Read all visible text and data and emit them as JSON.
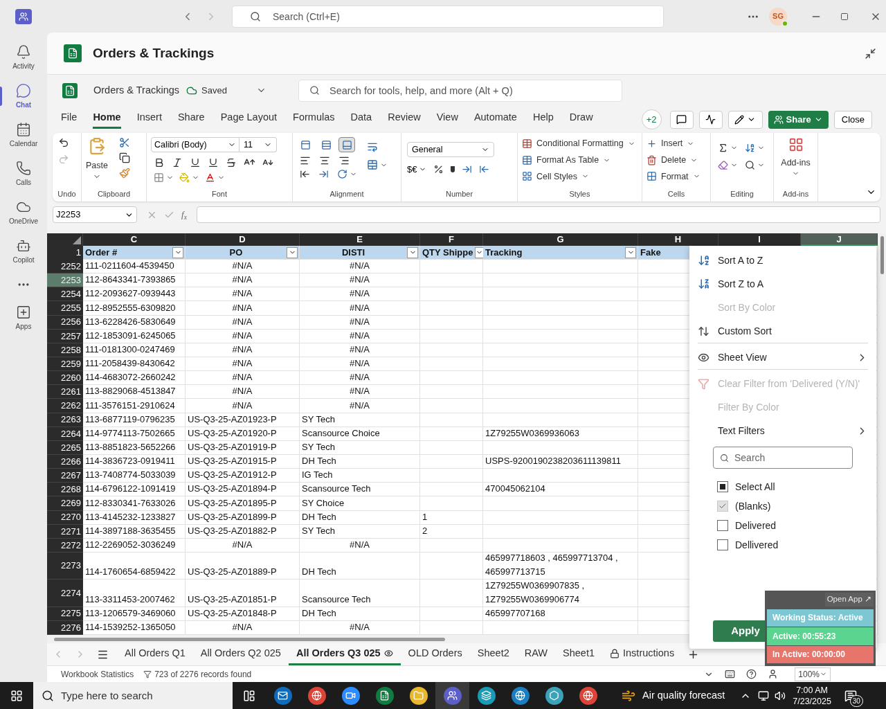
{
  "teams_bar": {
    "search_placeholder": "Search (Ctrl+E)",
    "avatar": "SG"
  },
  "rail": [
    {
      "label": "Activity",
      "selected": false
    },
    {
      "label": "Chat",
      "selected": true
    },
    {
      "label": "Calendar",
      "selected": false
    },
    {
      "label": "Calls",
      "selected": false
    },
    {
      "label": "OneDrive",
      "selected": false
    },
    {
      "label": "Copilot",
      "selected": false
    },
    {
      "label": "Apps",
      "selected": false
    }
  ],
  "app_header": {
    "title": "Orders & Trackings"
  },
  "excel_title": {
    "file_name": "Orders & Trackings",
    "save_status": "Saved",
    "search_placeholder": "Search for tools, help, and more (Alt + Q)"
  },
  "ribbon_tabs": [
    {
      "label": "File",
      "selected": false
    },
    {
      "label": "Home",
      "selected": true
    },
    {
      "label": "Insert",
      "selected": false
    },
    {
      "label": "Share",
      "selected": false
    },
    {
      "label": "Page Layout",
      "selected": false
    },
    {
      "label": "Formulas",
      "selected": false
    },
    {
      "label": "Data",
      "selected": false
    },
    {
      "label": "Review",
      "selected": false
    },
    {
      "label": "View",
      "selected": false
    },
    {
      "label": "Automate",
      "selected": false
    },
    {
      "label": "Help",
      "selected": false
    },
    {
      "label": "Draw",
      "selected": false
    }
  ],
  "collaborators": "+2",
  "share_button": "Share",
  "close_button": "Close",
  "ribbon": {
    "undo_group": "Undo",
    "paste": "Paste",
    "clipboard_group": "Clipboard",
    "font_name": "Calibri (Body)",
    "font_size": "11",
    "font_group": "Font",
    "valign_buttons": [
      {
        "selected": false
      },
      {
        "selected": false
      },
      {
        "selected": true
      }
    ],
    "alignment_group": "Alignment",
    "number_format": "General",
    "currency": "$€",
    "number_group": "Number",
    "styles": [
      "Conditional Formatting",
      "Format As Table",
      "Cell Styles"
    ],
    "styles_group": "Styles",
    "cells": [
      "Insert",
      "Delete",
      "Format"
    ],
    "cells_group": "Cells",
    "editing_group": "Editing",
    "addins": "Add-ins",
    "addins_group": "Add-ins"
  },
  "name_box": "J2253",
  "function_label": "f$_{x}$",
  "grid": {
    "columns": [
      {
        "letter": "C",
        "selected": false
      },
      {
        "letter": "D",
        "selected": false
      },
      {
        "letter": "E",
        "selected": false
      },
      {
        "letter": "F",
        "selected": false
      },
      {
        "letter": "G",
        "selected": false
      },
      {
        "letter": "H",
        "selected": false
      },
      {
        "letter": "I",
        "selected": false
      },
      {
        "letter": "J",
        "selected": true
      }
    ],
    "header_row": {
      "number": "1",
      "cells": [
        {
          "text": "Order #",
          "centered": false,
          "filter": true
        },
        {
          "text": "PO",
          "centered": true,
          "filter": true
        },
        {
          "text": "DISTI",
          "centered": true,
          "filter": true
        },
        {
          "text": "QTY Shippe",
          "centered": false,
          "filter": true
        },
        {
          "text": "Tracking",
          "centered": false,
          "filter": true
        },
        {
          "text": "Fake",
          "centered": false,
          "filter": false
        }
      ]
    },
    "rows": [
      {
        "number": "2252",
        "selected": false,
        "cells": [
          "111-0211604-4539450",
          {
            "text": "#N/A",
            "centered": true
          },
          {
            "text": "#N/A",
            "centered": true
          },
          null,
          null
        ]
      },
      {
        "number": "2253",
        "selected": true,
        "cells": [
          "112-8643341-7393865",
          {
            "text": "#N/A",
            "centered": true
          },
          {
            "text": "#N/A",
            "centered": true
          },
          null,
          null
        ]
      },
      {
        "number": "2254",
        "selected": false,
        "cells": [
          "112-2093627-0939443",
          {
            "text": "#N/A",
            "centered": true
          },
          {
            "text": "#N/A",
            "centered": true
          },
          null,
          null
        ]
      },
      {
        "number": "2255",
        "selected": false,
        "cells": [
          "112-8952555-6309820",
          {
            "text": "#N/A",
            "centered": true
          },
          {
            "text": "#N/A",
            "centered": true
          },
          null,
          null
        ]
      },
      {
        "number": "2256",
        "selected": false,
        "cells": [
          "113-6228426-5830649",
          {
            "text": "#N/A",
            "centered": true
          },
          {
            "text": "#N/A",
            "centered": true
          },
          null,
          null
        ]
      },
      {
        "number": "2257",
        "selected": false,
        "cells": [
          "112-1853091-6245065",
          {
            "text": "#N/A",
            "centered": true
          },
          {
            "text": "#N/A",
            "centered": true
          },
          null,
          null
        ]
      },
      {
        "number": "2258",
        "selected": false,
        "cells": [
          "111-0181300-0247469",
          {
            "text": "#N/A",
            "centered": true
          },
          {
            "text": "#N/A",
            "centered": true
          },
          null,
          null
        ]
      },
      {
        "number": "2259",
        "selected": false,
        "cells": [
          "111-2058439-8430642",
          {
            "text": "#N/A",
            "centered": true
          },
          {
            "text": "#N/A",
            "centered": true
          },
          null,
          null
        ]
      },
      {
        "number": "2260",
        "selected": false,
        "cells": [
          "114-4683072-2660242",
          {
            "text": "#N/A",
            "centered": true
          },
          {
            "text": "#N/A",
            "centered": true
          },
          null,
          null
        ]
      },
      {
        "number": "2261",
        "selected": false,
        "cells": [
          "113-8829068-4513847",
          {
            "text": "#N/A",
            "centered": true
          },
          {
            "text": "#N/A",
            "centered": true
          },
          null,
          null
        ]
      },
      {
        "number": "2262",
        "selected": false,
        "cells": [
          "111-3576151-2910624",
          {
            "text": "#N/A",
            "centered": true
          },
          {
            "text": "#N/A",
            "centered": true
          },
          null,
          null
        ]
      },
      {
        "number": "2263",
        "selected": false,
        "cells": [
          "113-6877119-0796235",
          "US-Q3-25-AZ01923-P",
          "SY Tech",
          null,
          null
        ]
      },
      {
        "number": "2264",
        "selected": false,
        "cells": [
          "114-9774113-7502665",
          "US-Q3-25-AZ01920-P",
          "Scansource Choice",
          null,
          "1Z79255W0369936063"
        ]
      },
      {
        "number": "2265",
        "selected": false,
        "cells": [
          "113-8851823-5652266",
          "US-Q3-25-AZ01919-P",
          "SY Tech",
          null,
          null
        ]
      },
      {
        "number": "2266",
        "selected": false,
        "cells": [
          "114-3836723-0919411",
          "US-Q3-25-AZ01915-P",
          "DH Tech",
          null,
          "USPS-9200190238203611139811"
        ]
      },
      {
        "number": "2267",
        "selected": false,
        "cells": [
          "113-7408774-5033039",
          "US-Q3-25-AZ01912-P",
          "IG Tech",
          null,
          null
        ]
      },
      {
        "number": "2268",
        "selected": false,
        "cells": [
          "114-6796122-1091419",
          "US-Q3-25-AZ01894-P",
          "Scansource Tech",
          null,
          "470045062104"
        ]
      },
      {
        "number": "2269",
        "selected": false,
        "cells": [
          "112-8330341-7633026",
          "US-Q3-25-AZ01895-P",
          "SY Choice",
          null,
          null
        ]
      },
      {
        "number": "2270",
        "selected": false,
        "cells": [
          "113-4145232-1233827",
          "US-Q3-25-AZ01899-P",
          "DH Tech",
          "1",
          null
        ]
      },
      {
        "number": "2271",
        "selected": false,
        "cells": [
          "114-3897188-3635455",
          "US-Q3-25-AZ01882-P",
          "SY Tech",
          "2",
          null
        ]
      },
      {
        "number": "2272",
        "selected": false,
        "cells": [
          "112-2269052-3036249",
          {
            "text": "#N/A",
            "centered": true
          },
          {
            "text": "#N/A",
            "centered": true
          },
          null,
          null
        ]
      },
      {
        "number": "2273",
        "selected": false,
        "cells": [
          "114-1760654-6859422",
          "US-Q3-25-AZ01889-P",
          "DH Tech",
          null,
          "465997718603 , 465997713704 , 465997713715"
        ]
      },
      {
        "number": "2274",
        "selected": false,
        "cells": [
          "113-3311453-2007462",
          "US-Q3-25-AZ01851-P",
          "Scansource Tech",
          null,
          "1Z79255W0369907835 , 1Z79255W0369906774"
        ]
      },
      {
        "number": "2275",
        "selected": false,
        "cells": [
          "113-1206579-3469060",
          "US-Q3-25-AZ01848-P",
          "DH Tech",
          null,
          "465997707168"
        ]
      },
      {
        "number": "2276",
        "selected": false,
        "cells": [
          "114-1539252-1365050",
          {
            "text": "#N/A",
            "centered": true
          },
          {
            "text": "#N/A",
            "centered": true
          },
          null,
          null
        ]
      }
    ]
  },
  "filter_menu": {
    "items": [
      {
        "label": "Sort A to Z",
        "kind": "sort-asc",
        "disabled": false,
        "submenu": false,
        "separator_after": false
      },
      {
        "label": "Sort Z to A",
        "kind": "sort-desc",
        "disabled": false,
        "submenu": false,
        "separator_after": false
      },
      {
        "label": "Sort By Color",
        "kind": "plain",
        "disabled": true,
        "submenu": false,
        "separator_after": false
      },
      {
        "label": "Custom Sort",
        "kind": "custom-sort",
        "disabled": false,
        "submenu": false,
        "separator_after": true
      },
      {
        "label": "Sheet View",
        "kind": "sheet-view",
        "disabled": false,
        "submenu": true,
        "separator_after": true
      },
      {
        "label": "Clear Filter from 'Delivered (Y/N)'",
        "kind": "clear-filter",
        "disabled": true,
        "submenu": false,
        "separator_after": false
      },
      {
        "label": "Filter By Color",
        "kind": "plain",
        "disabled": true,
        "submenu": false,
        "separator_after": false
      },
      {
        "label": "Text Filters",
        "kind": "plain",
        "disabled": false,
        "submenu": true,
        "separator_after": false
      }
    ],
    "search_placeholder": "Search",
    "values": [
      {
        "label": "Select All",
        "checked": false,
        "indeterminate": true
      },
      {
        "label": "(Blanks)",
        "checked": true,
        "indeterminate": false
      },
      {
        "label": "Delivered",
        "checked": false,
        "indeterminate": false
      },
      {
        "label": "Dellivered",
        "checked": false,
        "indeterminate": false
      }
    ],
    "apply_button": "Apply"
  },
  "sheet_tabs": [
    {
      "label": "All Orders Q1",
      "selected": false,
      "sheet_view": false,
      "locked": false
    },
    {
      "label": "All Orders Q2 025",
      "selected": false,
      "sheet_view": false,
      "locked": false
    },
    {
      "label": "All Orders Q3 025",
      "selected": true,
      "sheet_view": true,
      "locked": false
    },
    {
      "label": "OLD Orders",
      "selected": false,
      "sheet_view": false,
      "locked": false
    },
    {
      "label": "Sheet2",
      "selected": false,
      "sheet_view": false,
      "locked": false
    },
    {
      "label": "RAW",
      "selected": false,
      "sheet_view": false,
      "locked": false
    },
    {
      "label": "Sheet1",
      "selected": false,
      "sheet_view": false,
      "locked": false
    },
    {
      "label": "Instructions",
      "selected": false,
      "sheet_view": false,
      "locked": true
    }
  ],
  "status_bar": {
    "workbook_statistics": "Workbook Statistics",
    "filter_count": "723 of 2276 records found",
    "zoom": "100%"
  },
  "tracker": {
    "open_app": "Open App ↗",
    "rows": [
      {
        "text": "Working Status: Active",
        "color": "#7cc7d2"
      },
      {
        "text": "Active: 00:55:23",
        "color": "#5ad48e"
      },
      {
        "text": "In Active: 00:00:00",
        "color": "#e8756b"
      }
    ]
  },
  "taskbar": {
    "search_placeholder": "Type here to search",
    "weather": "Air quality forecast",
    "time": "7:00 AM",
    "date": "7/23/2025",
    "notifications": "30"
  }
}
